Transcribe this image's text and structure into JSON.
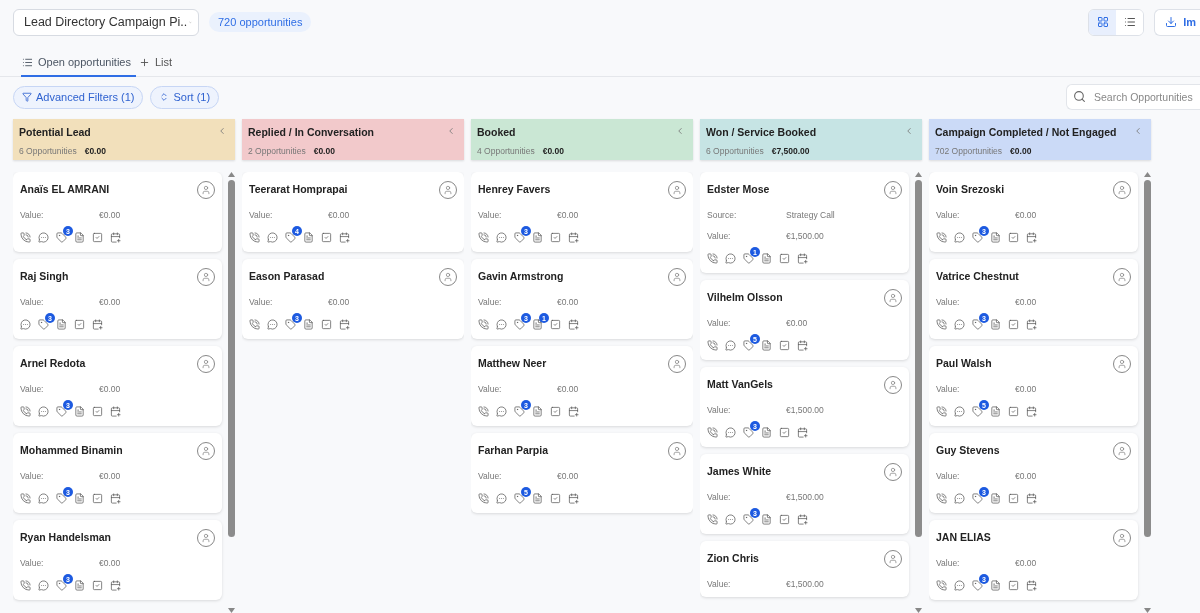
{
  "pipeline": {
    "value": "Lead Directory Campaign Pi.."
  },
  "count_badge": "720 opportunities",
  "view_toggle": [
    {
      "kind": "grid",
      "selected": true
    },
    {
      "kind": "list",
      "selected": false
    }
  ],
  "import_button": {
    "label": "Im"
  },
  "tabs": [
    {
      "kind": "list",
      "label": "Open opportunities",
      "selected": true
    },
    {
      "kind": "add",
      "label": "List",
      "selected": false
    }
  ],
  "filters": [
    {
      "kind": "filter",
      "label": "Advanced Filters (1)"
    },
    {
      "kind": "sort",
      "label": "Sort (1)"
    }
  ],
  "search": {
    "placeholder": "Search Opportunities"
  },
  "columns": [
    {
      "title": "Potential Lead",
      "count": "6 Opportunities",
      "total": "€0.00",
      "color": "#f2e0bb",
      "cards": [
        {
          "name": "Anaïs EL AMRANI",
          "fields": [
            {
              "label": "Value:",
              "value": "€0.00"
            }
          ],
          "actions": [
            {
              "kind": "call"
            },
            {
              "kind": "message"
            },
            {
              "kind": "tag",
              "badge": "3"
            },
            {
              "kind": "note"
            },
            {
              "kind": "task"
            },
            {
              "kind": "appointment"
            }
          ]
        },
        {
          "name": "Raj Singh",
          "fields": [
            {
              "label": "Value:",
              "value": "€0.00"
            }
          ],
          "actions": [
            {
              "kind": "message"
            },
            {
              "kind": "tag",
              "badge": "3"
            },
            {
              "kind": "note"
            },
            {
              "kind": "task"
            },
            {
              "kind": "appointment"
            }
          ]
        },
        {
          "name": "Arnel Redota",
          "fields": [
            {
              "label": "Value:",
              "value": "€0.00"
            }
          ],
          "actions": [
            {
              "kind": "call"
            },
            {
              "kind": "message"
            },
            {
              "kind": "tag",
              "badge": "3"
            },
            {
              "kind": "note"
            },
            {
              "kind": "task"
            },
            {
              "kind": "appointment"
            }
          ]
        },
        {
          "name": "Mohammed Binamin",
          "fields": [
            {
              "label": "Value:",
              "value": "€0.00"
            }
          ],
          "actions": [
            {
              "kind": "call"
            },
            {
              "kind": "message"
            },
            {
              "kind": "tag",
              "badge": "3"
            },
            {
              "kind": "note"
            },
            {
              "kind": "task"
            },
            {
              "kind": "appointment"
            }
          ]
        },
        {
          "name": "Ryan Handelsman",
          "fields": [
            {
              "label": "Value:",
              "value": "€0.00"
            }
          ],
          "actions": [
            {
              "kind": "call"
            },
            {
              "kind": "message"
            },
            {
              "kind": "tag",
              "badge": "3"
            },
            {
              "kind": "note"
            },
            {
              "kind": "task"
            },
            {
              "kind": "appointment"
            }
          ]
        }
      ]
    },
    {
      "title": "Replied / In Conversation",
      "count": "2 Opportunities",
      "total": "€0.00",
      "color": "#f2c9cb",
      "cards": [
        {
          "name": "Teerarat Homprapai",
          "fields": [
            {
              "label": "Value:",
              "value": "€0.00"
            }
          ],
          "actions": [
            {
              "kind": "call"
            },
            {
              "kind": "message"
            },
            {
              "kind": "tag",
              "badge": "4"
            },
            {
              "kind": "note"
            },
            {
              "kind": "task"
            },
            {
              "kind": "appointment"
            }
          ]
        },
        {
          "name": "Eason Parasad",
          "fields": [
            {
              "label": "Value:",
              "value": "€0.00"
            }
          ],
          "actions": [
            {
              "kind": "call"
            },
            {
              "kind": "message"
            },
            {
              "kind": "tag",
              "badge": "3"
            },
            {
              "kind": "note"
            },
            {
              "kind": "task"
            },
            {
              "kind": "appointment"
            }
          ]
        }
      ]
    },
    {
      "title": "Booked",
      "count": "4 Opportunities",
      "total": "€0.00",
      "color": "#cae7d4",
      "cards": [
        {
          "name": "Henrey Favers",
          "fields": [
            {
              "label": "Value:",
              "value": "€0.00"
            }
          ],
          "actions": [
            {
              "kind": "call"
            },
            {
              "kind": "message"
            },
            {
              "kind": "tag",
              "badge": "3"
            },
            {
              "kind": "note"
            },
            {
              "kind": "task"
            },
            {
              "kind": "appointment"
            }
          ]
        },
        {
          "name": "Gavin Armstrong",
          "fields": [
            {
              "label": "Value:",
              "value": "€0.00"
            }
          ],
          "actions": [
            {
              "kind": "call"
            },
            {
              "kind": "message"
            },
            {
              "kind": "tag",
              "badge": "3"
            },
            {
              "kind": "note",
              "badge": "1"
            },
            {
              "kind": "task"
            },
            {
              "kind": "appointment"
            }
          ]
        },
        {
          "name": "Matthew Neer",
          "fields": [
            {
              "label": "Value:",
              "value": "€0.00"
            }
          ],
          "actions": [
            {
              "kind": "call"
            },
            {
              "kind": "message"
            },
            {
              "kind": "tag",
              "badge": "3"
            },
            {
              "kind": "note"
            },
            {
              "kind": "task"
            },
            {
              "kind": "appointment"
            }
          ]
        },
        {
          "name": "Farhan Parpia",
          "fields": [
            {
              "label": "Value:",
              "value": "€0.00"
            }
          ],
          "actions": [
            {
              "kind": "call"
            },
            {
              "kind": "message"
            },
            {
              "kind": "tag",
              "badge": "5"
            },
            {
              "kind": "note"
            },
            {
              "kind": "task"
            },
            {
              "kind": "appointment"
            }
          ]
        }
      ]
    },
    {
      "title": "Won / Service Booked",
      "count": "6 Opportunities",
      "total": "€7,500.00",
      "color": "#c6e4e4",
      "cards": [
        {
          "name": "Edster Mose",
          "fields": [
            {
              "label": "Source:",
              "value": "Strategy Call"
            },
            {
              "label": "Value:",
              "value": "€1,500.00"
            }
          ],
          "actions": [
            {
              "kind": "call"
            },
            {
              "kind": "message"
            },
            {
              "kind": "tag",
              "badge": "1"
            },
            {
              "kind": "note"
            },
            {
              "kind": "task"
            },
            {
              "kind": "appointment"
            }
          ]
        },
        {
          "name": "Vilhelm Olsson",
          "fields": [
            {
              "label": "Value:",
              "value": "€0.00"
            }
          ],
          "actions": [
            {
              "kind": "call"
            },
            {
              "kind": "message"
            },
            {
              "kind": "tag",
              "badge": "5"
            },
            {
              "kind": "note"
            },
            {
              "kind": "task"
            },
            {
              "kind": "appointment"
            }
          ]
        },
        {
          "name": "Matt VanGels",
          "fields": [
            {
              "label": "Value:",
              "value": "€1,500.00"
            }
          ],
          "actions": [
            {
              "kind": "call"
            },
            {
              "kind": "message"
            },
            {
              "kind": "tag",
              "badge": "3"
            },
            {
              "kind": "note"
            },
            {
              "kind": "task"
            },
            {
              "kind": "appointment"
            }
          ]
        },
        {
          "name": "James White",
          "fields": [
            {
              "label": "Value:",
              "value": "€1,500.00"
            }
          ],
          "actions": [
            {
              "kind": "call"
            },
            {
              "kind": "message"
            },
            {
              "kind": "tag",
              "badge": "3"
            },
            {
              "kind": "note"
            },
            {
              "kind": "task"
            },
            {
              "kind": "appointment"
            }
          ]
        },
        {
          "name": "Zion Chris",
          "fields": [
            {
              "label": "Value:",
              "value": "€1,500.00"
            }
          ]
        }
      ]
    },
    {
      "title": "Campaign Completed / Not Engaged",
      "count": "702 Opportunities",
      "total": "€0.00",
      "color": "#cbdaf7",
      "cards": [
        {
          "name": "Voin Srezoski",
          "fields": [
            {
              "label": "Value:",
              "value": "€0.00"
            }
          ],
          "actions": [
            {
              "kind": "call"
            },
            {
              "kind": "message"
            },
            {
              "kind": "tag",
              "badge": "3"
            },
            {
              "kind": "note"
            },
            {
              "kind": "task"
            },
            {
              "kind": "appointment"
            }
          ]
        },
        {
          "name": "Vatrice Chestnut",
          "fields": [
            {
              "label": "Value:",
              "value": "€0.00"
            }
          ],
          "actions": [
            {
              "kind": "call"
            },
            {
              "kind": "message"
            },
            {
              "kind": "tag",
              "badge": "3"
            },
            {
              "kind": "note"
            },
            {
              "kind": "task"
            },
            {
              "kind": "appointment"
            }
          ]
        },
        {
          "name": "Paul Walsh",
          "fields": [
            {
              "label": "Value:",
              "value": "€0.00"
            }
          ],
          "actions": [
            {
              "kind": "call"
            },
            {
              "kind": "message"
            },
            {
              "kind": "tag",
              "badge": "5"
            },
            {
              "kind": "note"
            },
            {
              "kind": "task"
            },
            {
              "kind": "appointment"
            }
          ]
        },
        {
          "name": "Guy Stevens",
          "fields": [
            {
              "label": "Value:",
              "value": "€0.00"
            }
          ],
          "actions": [
            {
              "kind": "call"
            },
            {
              "kind": "message"
            },
            {
              "kind": "tag",
              "badge": "3"
            },
            {
              "kind": "note"
            },
            {
              "kind": "task"
            },
            {
              "kind": "appointment"
            }
          ]
        },
        {
          "name": "JAN ELIAS",
          "fields": [
            {
              "label": "Value:",
              "value": "€0.00"
            }
          ],
          "actions": [
            {
              "kind": "call"
            },
            {
              "kind": "message"
            },
            {
              "kind": "tag",
              "badge": "3"
            },
            {
              "kind": "note"
            },
            {
              "kind": "task"
            },
            {
              "kind": "appointment"
            }
          ]
        }
      ]
    }
  ]
}
